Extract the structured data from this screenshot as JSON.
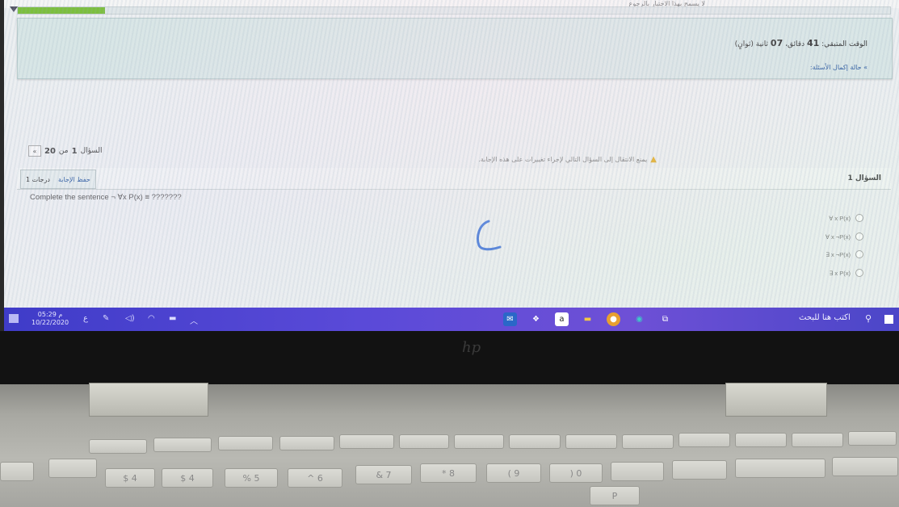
{
  "top_note": "لا يسمح بهذا الاختبار بالرجوع",
  "timer": {
    "label": "الوقت المتبقي:",
    "minutes": "41",
    "minutes_unit": "دقائق،",
    "seconds": "07",
    "seconds_unit": "ثانية (ثوانٍ)"
  },
  "hide_status": "» حالة إكمال الأسئلة:",
  "question_nav": {
    "label": "السؤال",
    "current": "1",
    "of": "من",
    "total": "20",
    "next_icon": "chevron-right-icon",
    "next_glyph": "»"
  },
  "warning": "يمنع الانتقال إلى السؤال التالي لإجراء تغييرات على هذه الإجابة.",
  "question": {
    "title": "السؤال 1",
    "points": "1 درجات",
    "save_label": "حفظ الإجابة",
    "text": "Complete the sentence ¬ ∀x P(x) ≡ ???????",
    "options": [
      "∀ x P(x)",
      "∀ x ¬P(x)",
      "∃ x ¬P(x)",
      "∃ x P(x)"
    ]
  },
  "progress_fraction": 0.1,
  "taskbar": {
    "time": "05:29 م",
    "date": "10/22/2020",
    "lang": "ع",
    "search_placeholder": "اكتب هنا للبحث"
  },
  "bezel_logo": "hp",
  "keyboard": {
    "number_row": [
      "$ 4",
      "% 5",
      "^ 6",
      "& 7",
      "* 8",
      "( 9",
      ") 0"
    ],
    "letter_keys": [
      "P"
    ]
  },
  "colors": {
    "taskbar": "#4b46c8",
    "progress": "#7cbf3e",
    "panel": "#d8e6e6",
    "pen": "#1e5bd6"
  }
}
